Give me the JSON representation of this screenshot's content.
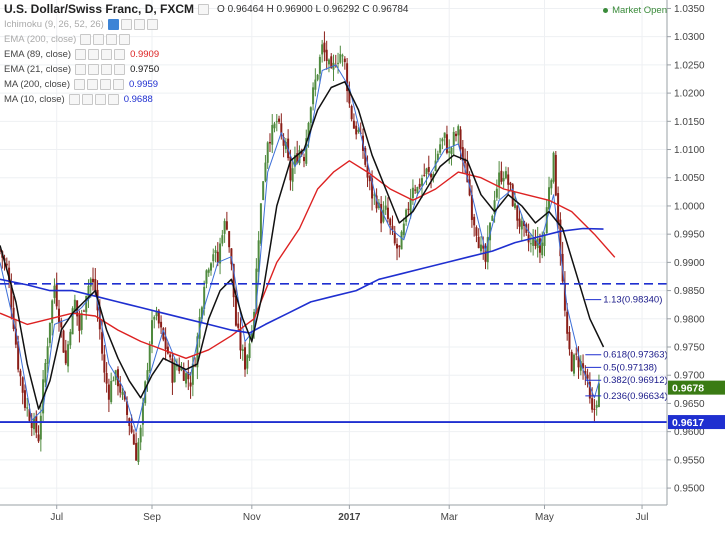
{
  "header": {
    "title": "U.S. Dollar/Swiss Franc, D, FXCM",
    "ohlc": "O 0.96464  H 0.96900  L 0.96292  C 0.96784",
    "market_status": "Market Open"
  },
  "indicators": [
    {
      "label": "Ichimoku (9, 26, 52, 26)",
      "value": "",
      "color": "#999999",
      "muted": true
    },
    {
      "label": "EMA (200, close)",
      "value": "",
      "color": "#999999",
      "muted": true
    },
    {
      "label": "EMA (89, close)",
      "value": "0.9909",
      "color": "#dd2222",
      "muted": false
    },
    {
      "label": "EMA (21, close)",
      "value": "0.9750",
      "color": "#111111",
      "muted": false
    },
    {
      "label": "MA (200, close)",
      "value": "0.9959",
      "color": "#1f2fd0",
      "muted": false
    },
    {
      "label": "MA (10, close)",
      "value": "0.9688",
      "color": "#1f2fd0",
      "muted": false
    }
  ],
  "chart_data": {
    "type": "candlestick",
    "x_tick_labels": [
      "Jul",
      "Sep",
      "Nov",
      "2017",
      "Mar",
      "May",
      "Jul"
    ],
    "x_tick_positions": [
      3,
      45,
      89,
      132,
      176,
      218,
      261
    ],
    "x_range": [
      -22,
      272
    ],
    "y_ticks": [
      "1.0350",
      "1.0300",
      "1.0250",
      "1.0200",
      "1.0150",
      "1.0100",
      "1.0050",
      "1.0000",
      "0.9950",
      "0.9900",
      "0.9850",
      "0.9800",
      "0.9750",
      "0.9700",
      "0.9650",
      "0.9600",
      "0.9550",
      "0.9500"
    ],
    "ylim": [
      0.947,
      1.0365
    ],
    "current_price": {
      "value": 0.9678,
      "label": "0.9678",
      "color": "#3a7b14"
    },
    "support_line": {
      "value": 0.9617,
      "label": "0.9617",
      "color": "#1f2fd0"
    },
    "dashed_resistance": {
      "value": 0.9862,
      "color": "#1f2fd0"
    },
    "fibonacci": [
      {
        "label": "1.13(0.98340)",
        "value": 0.9834
      },
      {
        "label": "0.618(0.97363)",
        "value": 0.97363
      },
      {
        "label": "0.5(0.97138)",
        "value": 0.97138
      },
      {
        "label": "0.382(0.96912)",
        "value": 0.96912
      },
      {
        "label": "0.236(0.96634)",
        "value": 0.96634
      }
    ],
    "candle_colors": {
      "up": "#4f8a3e",
      "down": "#8a1e18"
    },
    "anchors": [
      [
        -22,
        0.992
      ],
      [
        -19,
        0.989
      ],
      [
        -17,
        0.983
      ],
      [
        -14,
        0.972
      ],
      [
        -11,
        0.965
      ],
      [
        -8,
        0.962
      ],
      [
        -5,
        0.959
      ],
      [
        -3,
        0.968
      ],
      [
        0,
        0.98
      ],
      [
        2,
        0.986
      ],
      [
        5,
        0.978
      ],
      [
        7,
        0.972
      ],
      [
        9,
        0.979
      ],
      [
        11,
        0.983
      ],
      [
        13,
        0.978
      ],
      [
        16,
        0.985
      ],
      [
        18,
        0.987
      ],
      [
        20,
        0.985
      ],
      [
        22,
        0.978
      ],
      [
        24,
        0.97
      ],
      [
        26,
        0.967
      ],
      [
        28,
        0.97
      ],
      [
        30,
        0.969
      ],
      [
        32,
        0.966
      ],
      [
        34,
        0.963
      ],
      [
        36,
        0.96
      ],
      [
        38,
        0.956
      ],
      [
        40,
        0.96
      ],
      [
        42,
        0.968
      ],
      [
        44,
        0.976
      ],
      [
        46,
        0.981
      ],
      [
        48,
        0.979
      ],
      [
        50,
        0.976
      ],
      [
        52,
        0.974
      ],
      [
        54,
        0.97
      ],
      [
        56,
        0.972
      ],
      [
        58,
        0.971
      ],
      [
        60,
        0.97
      ],
      [
        62,
        0.969
      ],
      [
        64,
        0.973
      ],
      [
        66,
        0.98
      ],
      [
        68,
        0.987
      ],
      [
        70,
        0.99
      ],
      [
        72,
        0.992
      ],
      [
        74,
        0.99
      ],
      [
        76,
        0.996
      ],
      [
        78,
        0.997
      ],
      [
        80,
        0.989
      ],
      [
        82,
        0.979
      ],
      [
        84,
        0.975
      ],
      [
        86,
        0.972
      ],
      [
        88,
        0.976
      ],
      [
        90,
        0.982
      ],
      [
        92,
        0.995
      ],
      [
        94,
        1.005
      ],
      [
        96,
        1.012
      ],
      [
        98,
        1.013
      ],
      [
        100,
        1.015
      ],
      [
        102,
        1.012
      ],
      [
        104,
        1.01
      ],
      [
        106,
        1.005
      ],
      [
        108,
        1.008
      ],
      [
        110,
        1.01
      ],
      [
        112,
        1.009
      ],
      [
        114,
        1.016
      ],
      [
        116,
        1.02
      ],
      [
        118,
        1.024
      ],
      [
        120,
        1.028
      ],
      [
        122,
        1.026
      ],
      [
        124,
        1.023
      ],
      [
        126,
        1.026
      ],
      [
        128,
        1.027
      ],
      [
        130,
        1.025
      ],
      [
        132,
        1.018
      ],
      [
        134,
        1.014
      ],
      [
        136,
        1.013
      ],
      [
        138,
        1.01
      ],
      [
        140,
        1.005
      ],
      [
        142,
        1.002
      ],
      [
        144,
        1.001
      ],
      [
        146,
        0.998
      ],
      [
        148,
        0.999
      ],
      [
        150,
        0.996
      ],
      [
        152,
        0.993
      ],
      [
        154,
        0.992
      ],
      [
        156,
        0.996
      ],
      [
        158,
        1.0
      ],
      [
        160,
        1.004
      ],
      [
        162,
        1.003
      ],
      [
        164,
        1.005
      ],
      [
        166,
        1.006
      ],
      [
        168,
        1.005
      ],
      [
        170,
        1.008
      ],
      [
        172,
        1.011
      ],
      [
        174,
        1.012
      ],
      [
        176,
        1.009
      ],
      [
        178,
        1.012
      ],
      [
        180,
        1.013
      ],
      [
        182,
        1.008
      ],
      [
        184,
        1.005
      ],
      [
        186,
        0.999
      ],
      [
        188,
        0.996
      ],
      [
        190,
        0.992
      ],
      [
        192,
        0.99
      ],
      [
        194,
        0.996
      ],
      [
        196,
        1.002
      ],
      [
        198,
        1.005
      ],
      [
        200,
        1.006
      ],
      [
        202,
        1.004
      ],
      [
        204,
        1.001
      ],
      [
        206,
        0.998
      ],
      [
        208,
        0.996
      ],
      [
        210,
        0.994
      ],
      [
        212,
        0.993
      ],
      [
        214,
        0.994
      ],
      [
        216,
        0.992
      ],
      [
        218,
        0.995
      ],
      [
        220,
        1.004
      ],
      [
        222,
        1.008
      ],
      [
        224,
        0.998
      ],
      [
        226,
        0.986
      ],
      [
        228,
        0.976
      ],
      [
        230,
        0.972
      ],
      [
        232,
        0.973
      ],
      [
        234,
        0.972
      ],
      [
        236,
        0.97
      ],
      [
        237,
        0.968
      ],
      [
        238,
        0.965
      ],
      [
        239,
        0.963
      ],
      [
        240,
        0.964
      ],
      [
        241,
        0.966
      ],
      [
        242,
        0.9678
      ]
    ],
    "ema89": [
      [
        -22,
        0.981
      ],
      [
        -10,
        0.979
      ],
      [
        0,
        0.98
      ],
      [
        10,
        0.981
      ],
      [
        20,
        0.9805
      ],
      [
        30,
        0.978
      ],
      [
        40,
        0.976
      ],
      [
        50,
        0.9745
      ],
      [
        60,
        0.973
      ],
      [
        70,
        0.9745
      ],
      [
        80,
        0.977
      ],
      [
        90,
        0.98
      ],
      [
        100,
        0.99
      ],
      [
        110,
        0.996
      ],
      [
        118,
        1.003
      ],
      [
        125,
        1.006
      ],
      [
        132,
        1.008
      ],
      [
        140,
        1.006
      ],
      [
        150,
        1.003
      ],
      [
        160,
        1.001
      ],
      [
        170,
        1.003
      ],
      [
        180,
        1.006
      ],
      [
        190,
        1.005
      ],
      [
        200,
        1.003
      ],
      [
        210,
        1.002
      ],
      [
        220,
        1.001
      ],
      [
        230,
        0.999
      ],
      [
        240,
        0.995
      ],
      [
        249,
        0.9909
      ]
    ],
    "ema21": [
      [
        -22,
        0.993
      ],
      [
        -15,
        0.983
      ],
      [
        -10,
        0.972
      ],
      [
        -5,
        0.964
      ],
      [
        0,
        0.969
      ],
      [
        5,
        0.978
      ],
      [
        10,
        0.981
      ],
      [
        15,
        0.983
      ],
      [
        20,
        0.985
      ],
      [
        25,
        0.978
      ],
      [
        30,
        0.973
      ],
      [
        35,
        0.969
      ],
      [
        40,
        0.966
      ],
      [
        45,
        0.97
      ],
      [
        50,
        0.973
      ],
      [
        55,
        0.972
      ],
      [
        60,
        0.971
      ],
      [
        65,
        0.972
      ],
      [
        70,
        0.98
      ],
      [
        75,
        0.985
      ],
      [
        80,
        0.987
      ],
      [
        85,
        0.98
      ],
      [
        89,
        0.976
      ],
      [
        94,
        0.985
      ],
      [
        100,
        1.0
      ],
      [
        106,
        1.008
      ],
      [
        112,
        1.01
      ],
      [
        118,
        1.017
      ],
      [
        124,
        1.021
      ],
      [
        130,
        1.022
      ],
      [
        136,
        1.017
      ],
      [
        142,
        1.009
      ],
      [
        148,
        1.003
      ],
      [
        154,
        0.997
      ],
      [
        160,
        0.999
      ],
      [
        166,
        1.003
      ],
      [
        172,
        1.007
      ],
      [
        178,
        1.009
      ],
      [
        184,
        1.008
      ],
      [
        190,
        1.002
      ],
      [
        196,
        0.999
      ],
      [
        202,
        1.002
      ],
      [
        208,
        1.0
      ],
      [
        214,
        0.997
      ],
      [
        220,
        0.999
      ],
      [
        226,
        0.996
      ],
      [
        232,
        0.988
      ],
      [
        238,
        0.98
      ],
      [
        244,
        0.975
      ]
    ],
    "ma200": [
      [
        -22,
        0.987
      ],
      [
        -10,
        0.986
      ],
      [
        0,
        0.985
      ],
      [
        10,
        0.985
      ],
      [
        20,
        0.984
      ],
      [
        30,
        0.983
      ],
      [
        40,
        0.982
      ],
      [
        50,
        0.981
      ],
      [
        60,
        0.98
      ],
      [
        70,
        0.979
      ],
      [
        80,
        0.978
      ],
      [
        88,
        0.9775
      ],
      [
        95,
        0.979
      ],
      [
        105,
        0.981
      ],
      [
        115,
        0.983
      ],
      [
        125,
        0.984
      ],
      [
        135,
        0.985
      ],
      [
        145,
        0.987
      ],
      [
        155,
        0.988
      ],
      [
        165,
        0.989
      ],
      [
        175,
        0.99
      ],
      [
        185,
        0.991
      ],
      [
        195,
        0.992
      ],
      [
        205,
        0.9935
      ],
      [
        215,
        0.9945
      ],
      [
        225,
        0.9955
      ],
      [
        235,
        0.996
      ],
      [
        244,
        0.9959
      ]
    ],
    "ma10": [
      [
        -22,
        0.99
      ],
      [
        -14,
        0.976
      ],
      [
        -8,
        0.962
      ],
      [
        -3,
        0.964
      ],
      [
        2,
        0.979
      ],
      [
        8,
        0.98
      ],
      [
        14,
        0.982
      ],
      [
        20,
        0.985
      ],
      [
        26,
        0.972
      ],
      [
        32,
        0.968
      ],
      [
        38,
        0.96
      ],
      [
        44,
        0.97
      ],
      [
        50,
        0.978
      ],
      [
        56,
        0.972
      ],
      [
        62,
        0.97
      ],
      [
        68,
        0.982
      ],
      [
        74,
        0.99
      ],
      [
        80,
        0.991
      ],
      [
        86,
        0.976
      ],
      [
        90,
        0.978
      ],
      [
        96,
        1.006
      ],
      [
        102,
        1.013
      ],
      [
        108,
        1.007
      ],
      [
        114,
        1.011
      ],
      [
        120,
        1.024
      ],
      [
        126,
        1.025
      ],
      [
        132,
        1.021
      ],
      [
        138,
        1.011
      ],
      [
        144,
        1.001
      ],
      [
        150,
        0.996
      ],
      [
        156,
        0.994
      ],
      [
        162,
        1.002
      ],
      [
        168,
        1.006
      ],
      [
        174,
        1.01
      ],
      [
        180,
        1.011
      ],
      [
        186,
        1.002
      ],
      [
        192,
        0.992
      ],
      [
        198,
        1.001
      ],
      [
        204,
        1.003
      ],
      [
        210,
        0.996
      ],
      [
        216,
        0.993
      ],
      [
        222,
        1.002
      ],
      [
        228,
        0.982
      ],
      [
        234,
        0.972
      ],
      [
        240,
        0.966
      ],
      [
        242,
        0.9688
      ]
    ]
  }
}
